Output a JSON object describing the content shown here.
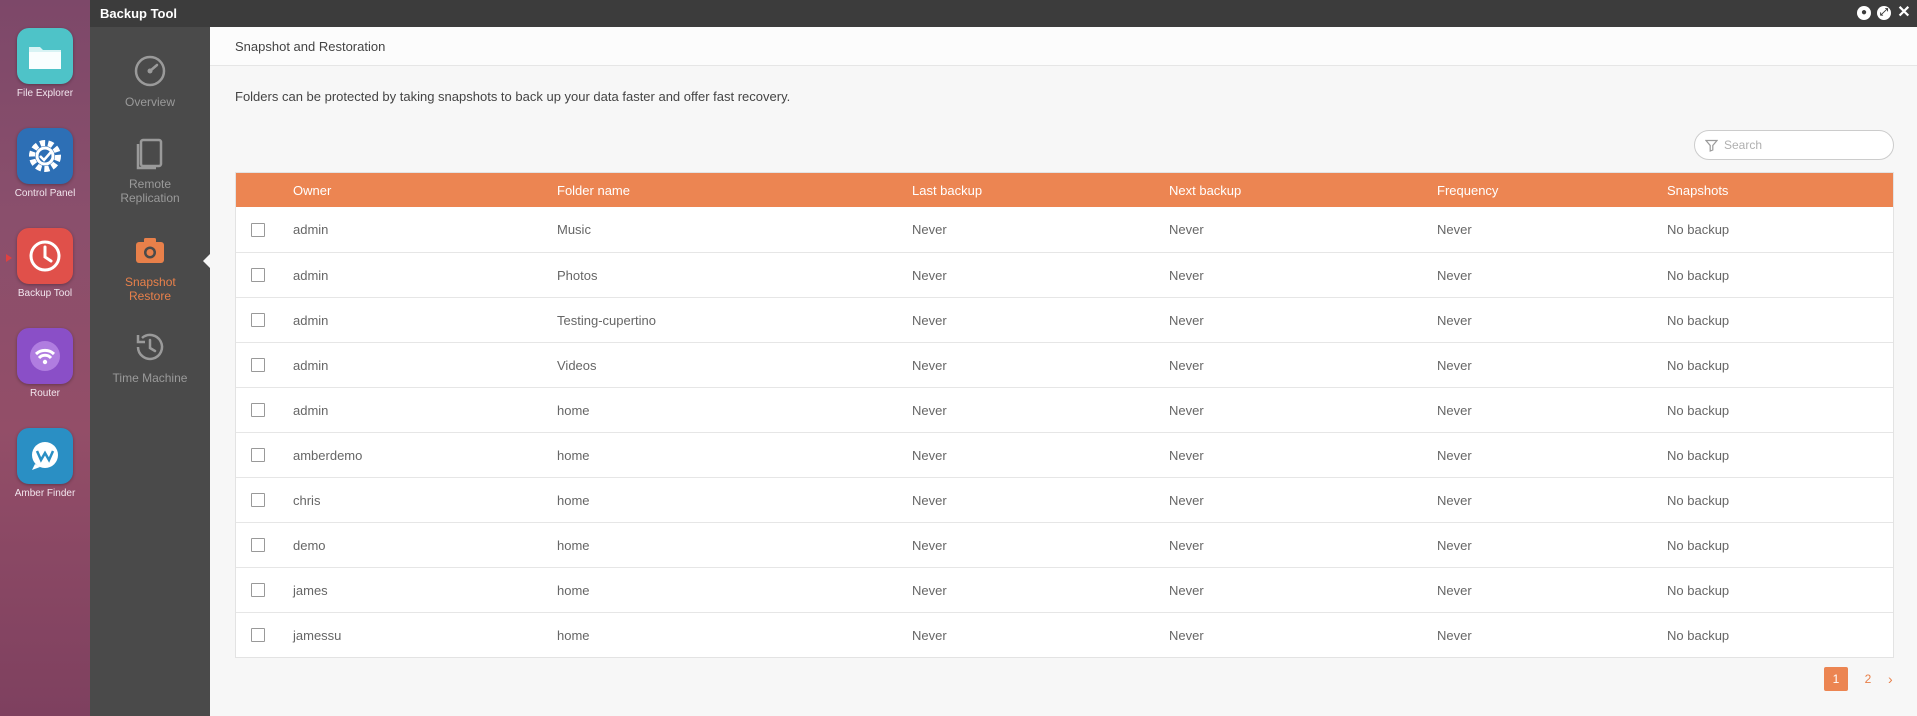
{
  "dock": {
    "apps": [
      {
        "label": "File Explorer",
        "icon": "folder-icon",
        "color": "#4ec3c8"
      },
      {
        "label": "Control Panel",
        "icon": "gear-icon",
        "color": "#2d6fb5"
      },
      {
        "label": "Backup Tool",
        "icon": "clock-icon",
        "color": "#e0504a"
      },
      {
        "label": "Router",
        "icon": "wifi-icon",
        "color": "#8a4fc7"
      },
      {
        "label": "Amber Finder",
        "icon": "chat-icon",
        "color": "#2a8fc4"
      }
    ]
  },
  "window": {
    "title": "Backup Tool",
    "controls": [
      "minimize",
      "maximize",
      "close"
    ]
  },
  "sidebar": {
    "items": [
      {
        "label": "Overview",
        "icon": "speedometer-icon",
        "active": false
      },
      {
        "label": "Remote Replication",
        "icon": "copy-icon",
        "active": false
      },
      {
        "label": "Snapshot Restore",
        "icon": "camera-icon",
        "active": true
      },
      {
        "label": "Time Machine",
        "icon": "history-icon",
        "active": false
      }
    ]
  },
  "content": {
    "header": "Snapshot and Restoration",
    "description": "Folders can be protected by taking snapshots to back up your data faster and offer fast recovery.",
    "search_placeholder": "Search"
  },
  "table": {
    "columns": [
      "Owner",
      "Folder name",
      "Last backup",
      "Next backup",
      "Frequency",
      "Snapshots"
    ],
    "rows": [
      {
        "owner": "admin",
        "folder": "Music",
        "last": "Never",
        "next": "Never",
        "freq": "Never",
        "snap": "No backup"
      },
      {
        "owner": "admin",
        "folder": "Photos",
        "last": "Never",
        "next": "Never",
        "freq": "Never",
        "snap": "No backup"
      },
      {
        "owner": "admin",
        "folder": "Testing-cupertino",
        "last": "Never",
        "next": "Never",
        "freq": "Never",
        "snap": "No backup"
      },
      {
        "owner": "admin",
        "folder": "Videos",
        "last": "Never",
        "next": "Never",
        "freq": "Never",
        "snap": "No backup"
      },
      {
        "owner": "admin",
        "folder": "home",
        "last": "Never",
        "next": "Never",
        "freq": "Never",
        "snap": "No backup"
      },
      {
        "owner": "amberdemo",
        "folder": "home",
        "last": "Never",
        "next": "Never",
        "freq": "Never",
        "snap": "No backup"
      },
      {
        "owner": "chris",
        "folder": "home",
        "last": "Never",
        "next": "Never",
        "freq": "Never",
        "snap": "No backup"
      },
      {
        "owner": "demo",
        "folder": "home",
        "last": "Never",
        "next": "Never",
        "freq": "Never",
        "snap": "No backup"
      },
      {
        "owner": "james",
        "folder": "home",
        "last": "Never",
        "next": "Never",
        "freq": "Never",
        "snap": "No backup"
      },
      {
        "owner": "jamessu",
        "folder": "home",
        "last": "Never",
        "next": "Never",
        "freq": "Never",
        "snap": "No backup"
      }
    ]
  },
  "pagination": {
    "pages": [
      "1",
      "2"
    ],
    "current": "1",
    "next": "›"
  },
  "colors": {
    "accent": "#ec8552",
    "titlebar": "#3c3c3c",
    "sidebar": "#4a4a4a"
  }
}
